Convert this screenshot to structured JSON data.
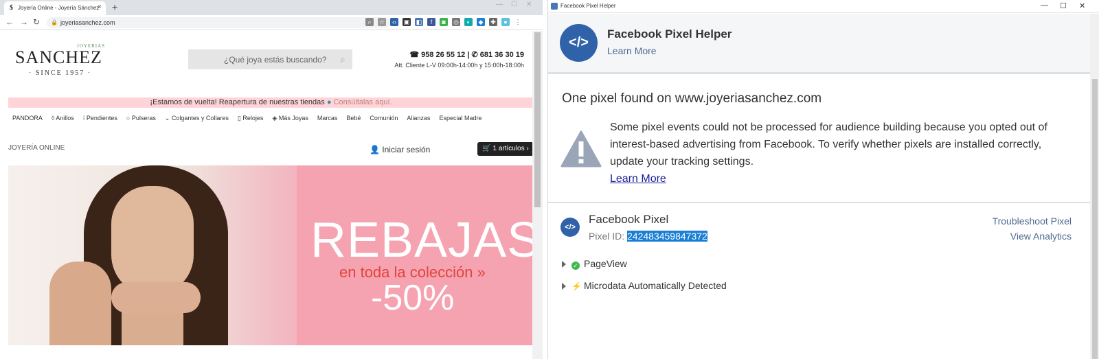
{
  "browser": {
    "tab_title": "Joyería Online - Joyería Sánchez",
    "tab_close": "×",
    "new_tab": "+",
    "url": "joyeriasanchez.com",
    "nav": {
      "back": "←",
      "forward": "→",
      "reload": "↻",
      "lock": "🔒"
    }
  },
  "site": {
    "logo": {
      "name": "SANCHEZ",
      "small": "JOYERIAS",
      "since": "· SINCE 1957 ·"
    },
    "search_placeholder": "¿Qué joya estás buscando?",
    "phones": "☎ 958 26 55 12 | ✆ 681 36 30 19",
    "hours": "Att. Cliente L-V 09:00h-14:00h y 15:00h-18:00h",
    "promo_text": "¡Estamos de vuelta! Reapertura de nuestras tiendas",
    "promo_link": "Consúltalas aquí.",
    "menu": [
      "PANDORA",
      "Anillos",
      "Pendientes",
      "Pulseras",
      "Colgantes y Collares",
      "Relojes",
      "Más Joyas",
      "Marcas",
      "Bebé",
      "Comunión",
      "Alianzas",
      "Especial Madre"
    ],
    "section_label": "JOYERÍA ONLINE",
    "login": "Iniciar sesión",
    "cart": "1 artículos ›",
    "banner": {
      "headline": "REBAJAS",
      "subline": "en toda la colección »",
      "discount": "-50%"
    }
  },
  "helper": {
    "window_title": "Facebook Pixel Helper",
    "title": "Facebook Pixel Helper",
    "learn_more": "Learn More",
    "found": "One pixel found on www.joyeriasanchez.com",
    "warning": "Some pixel events could not be processed for audience building because you opted out of interest-based advertising from Facebook. To verify whether pixels are installed correctly, update your tracking settings.",
    "warning_link": "Learn More",
    "pixel_name": "Facebook Pixel",
    "pixel_id_label": "Pixel ID: ",
    "pixel_id": "242483459847372",
    "troubleshoot": "Troubleshoot Pixel",
    "analytics": "View Analytics",
    "events": [
      {
        "name": "PageView",
        "icon": "check-icon"
      },
      {
        "name": "Microdata Automatically Detected",
        "icon": "lightning-icon"
      }
    ]
  }
}
